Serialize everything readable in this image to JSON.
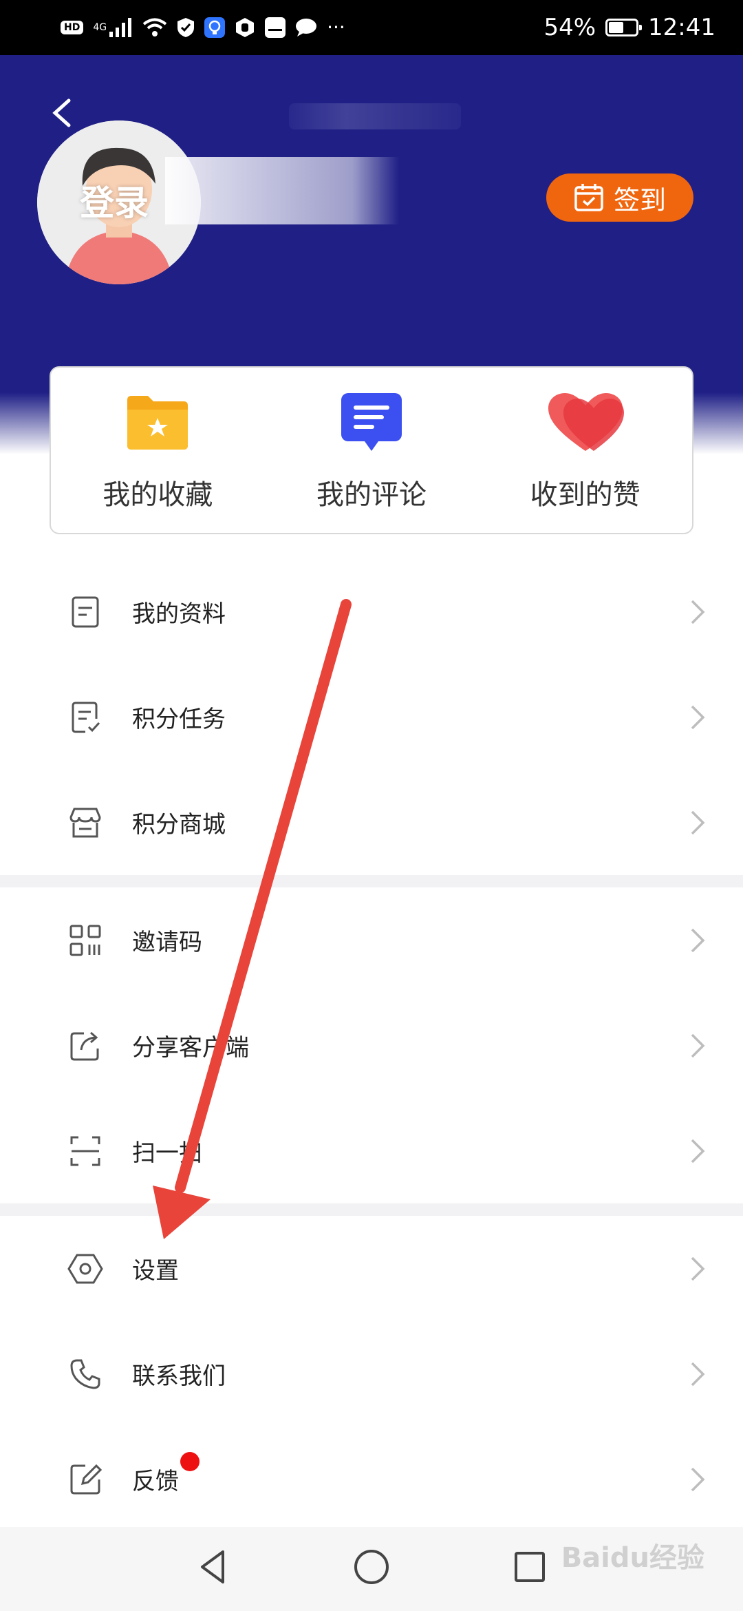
{
  "status_bar": {
    "hd_badge": "HD",
    "network": "4G",
    "battery_text": "54%",
    "battery_level": 0.54,
    "time": "12:41",
    "more": "···"
  },
  "header": {
    "login_text": "登录",
    "checkin_label": "签到",
    "background_color": "#1f1f86",
    "checkin_color": "#f0660f"
  },
  "quick_actions": [
    {
      "label": "我的收藏",
      "icon": "star-folder-icon"
    },
    {
      "label": "我的评论",
      "icon": "comment-icon"
    },
    {
      "label": "收到的赞",
      "icon": "heart-icon"
    }
  ],
  "menu_group_1": [
    {
      "label": "我的资料",
      "icon": "profile-doc-icon"
    },
    {
      "label": "积分任务",
      "icon": "task-list-icon"
    },
    {
      "label": "积分商城",
      "icon": "store-icon"
    }
  ],
  "menu_group_2": [
    {
      "label": "邀请码",
      "icon": "qr-code-icon"
    },
    {
      "label": "分享客户端",
      "icon": "share-icon"
    },
    {
      "label": "扫一扫",
      "icon": "scan-icon"
    }
  ],
  "menu_group_3": [
    {
      "label": "设置",
      "icon": "settings-icon"
    },
    {
      "label": "联系我们",
      "icon": "phone-icon"
    },
    {
      "label": "反馈",
      "icon": "feedback-icon"
    }
  ],
  "watermark": "Baidu经验",
  "annotation_color": "#e8443a"
}
